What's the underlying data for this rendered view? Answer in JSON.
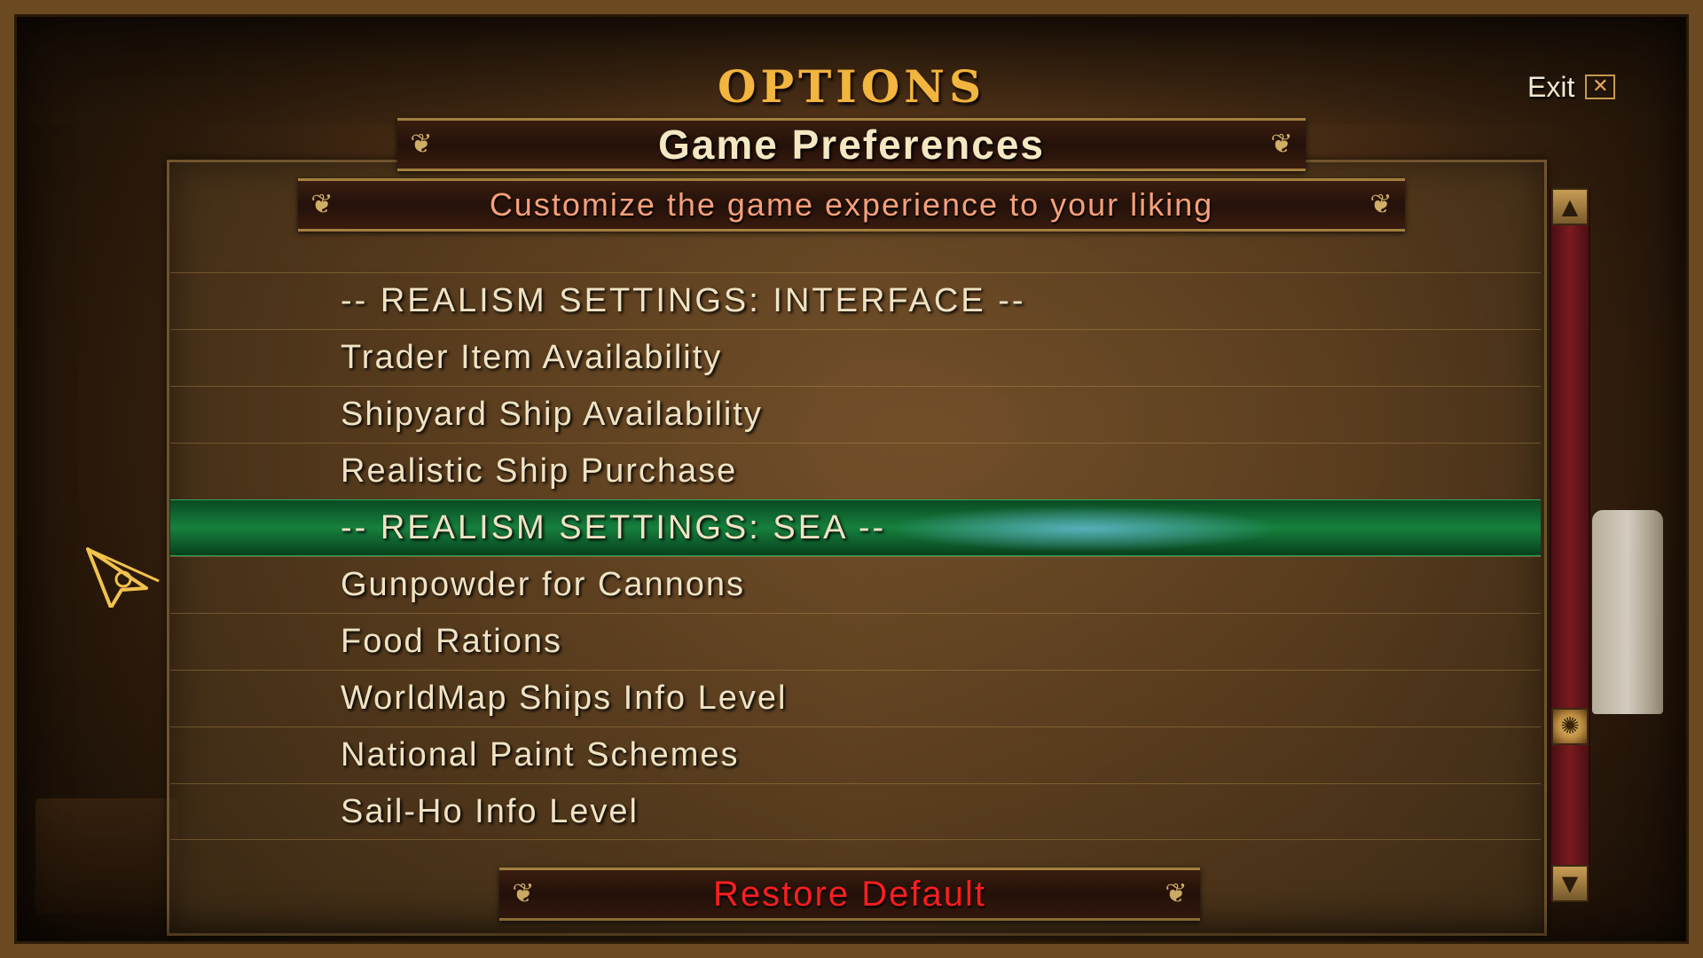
{
  "header": {
    "title": "OPTIONS",
    "exit_label": "Exit",
    "exit_icon": "close-icon"
  },
  "panel": {
    "title": "Game Preferences",
    "subtitle": "Customize the game experience to your liking"
  },
  "list": {
    "selected_index": 4,
    "items": [
      {
        "label": "-- REALISM SETTINGS: INTERFACE --"
      },
      {
        "label": "Trader Item Availability"
      },
      {
        "label": "Shipyard Ship Availability"
      },
      {
        "label": "Realistic Ship Purchase"
      },
      {
        "label": "-- REALISM SETTINGS: SEA --"
      },
      {
        "label": "Gunpowder for Cannons"
      },
      {
        "label": "Food Rations"
      },
      {
        "label": "WorldMap Ships Info Level"
      },
      {
        "label": "National Paint Schemes"
      },
      {
        "label": "Sail-Ho Info Level"
      }
    ]
  },
  "footer": {
    "restore_label": "Restore Default"
  },
  "scrollbar": {
    "up_icon": "arrow-up-icon",
    "down_icon": "arrow-down-icon",
    "thumb_icon": "sun-icon"
  },
  "cursor": {
    "icon": "compass-cursor-icon"
  },
  "colors": {
    "title": "#f2b640",
    "subtitle": "#f5a07a",
    "restore": "#ff2020",
    "selected_row": "#16803d",
    "scrollbar_track": "#7a1a20"
  }
}
